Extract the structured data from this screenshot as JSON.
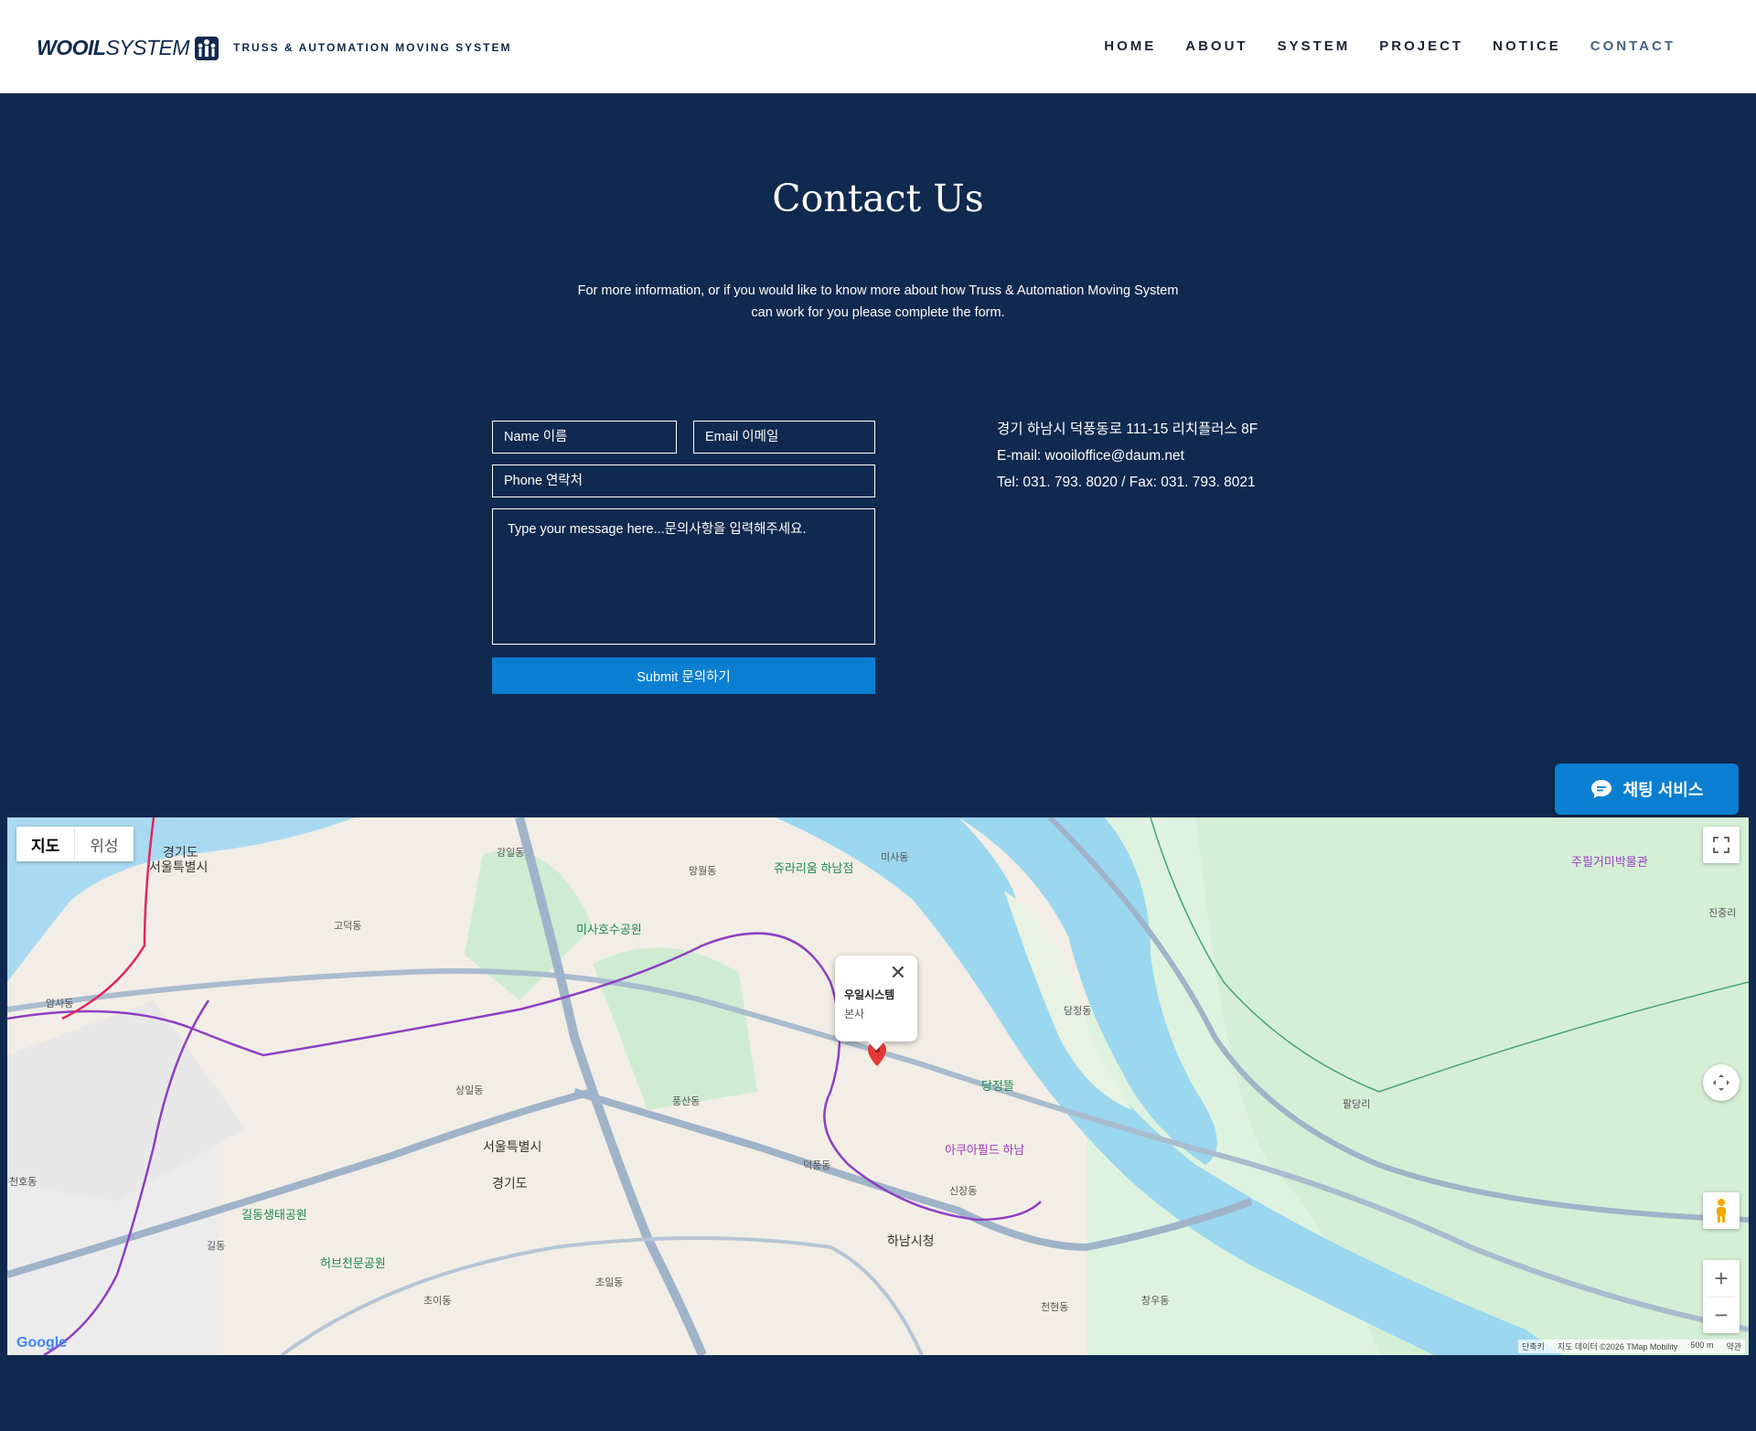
{
  "header": {
    "logo_bold": "WOOIL",
    "logo_light": "SYSTEM",
    "tagline": "TRUSS & AUTOMATION MOVING SYSTEM",
    "nav": [
      "HOME",
      "ABOUT",
      "SYSTEM",
      "PROJECT",
      "NOTICE",
      "CONTACT"
    ],
    "active_nav": "CONTACT"
  },
  "contact": {
    "title": "Contact Us",
    "intro_line1": "For more information, or if you would like to know more about how Truss & Automation Moving System",
    "intro_line2": "can work for you please complete the form.",
    "form": {
      "name_placeholder": "Name 이름",
      "email_placeholder": "Email 이메일",
      "phone_placeholder": "Phone 연락처",
      "message_placeholder": "Type your message here...문의사항을 입력해주세요.",
      "submit_label": "Submit 문의하기"
    },
    "info": {
      "address": "경기 하남시 덕풍동로 111-15 리치플러스 8F",
      "email": "E-mail: wooiloffice@daum.net",
      "tel_fax": "Tel: 031. 793. 8020  /  Fax: 031. 793. 8021"
    }
  },
  "chat": {
    "label": "채팅 서비스",
    "icon": "chat-bubble-icon"
  },
  "map": {
    "type_map": "지도",
    "type_satellite": "위성",
    "infowindow_title": "우일시스템",
    "infowindow_sub": "본사",
    "labels": {
      "gyeonggi_top": "경기도",
      "seoul_top": "서울특별시",
      "seoul_center": "서울특별시",
      "gyeonggi_center": "경기도",
      "misa_park": "미사호수공원",
      "jurio": "쥬라리움 하남점",
      "dangjeongddeul": "당정뜰",
      "aquafield": "아쿠아필드 하남",
      "hanam_cityhall": "하남시청",
      "gildong_park": "길동생태공원",
      "herb_park": "허브천문공원",
      "coffee_museum": "주필거미박물관",
      "dangjeong_dong": "당정동",
      "baldang_ri": "팔당리",
      "seoljeong_dong": "신장동",
      "deokpung_dong": "덕풍동",
      "pungsan_dong": "풍산동",
      "gangil_dong": "강일동",
      "godeok_dong": "고덕동",
      "sangil_dong": "상일동",
      "misa_dong": "미사동",
      "mangwol_dong": "망월동",
      "chungung_dong": "천현동",
      "chowoo_dong": "창우동",
      "chogil_dong": "초일동",
      "cheonho_dong": "천호동",
      "amsa_dong": "암사동",
      "gil_dong": "길동",
      "jinjung_ri": "진중리",
      "jiknam_dong": "초이동"
    },
    "attribution": {
      "shortcuts": "단축키",
      "data": "지도 데이터 ©2026 TMap Mobility",
      "scale": "500 m",
      "terms": "약관"
    },
    "google": "Google"
  }
}
